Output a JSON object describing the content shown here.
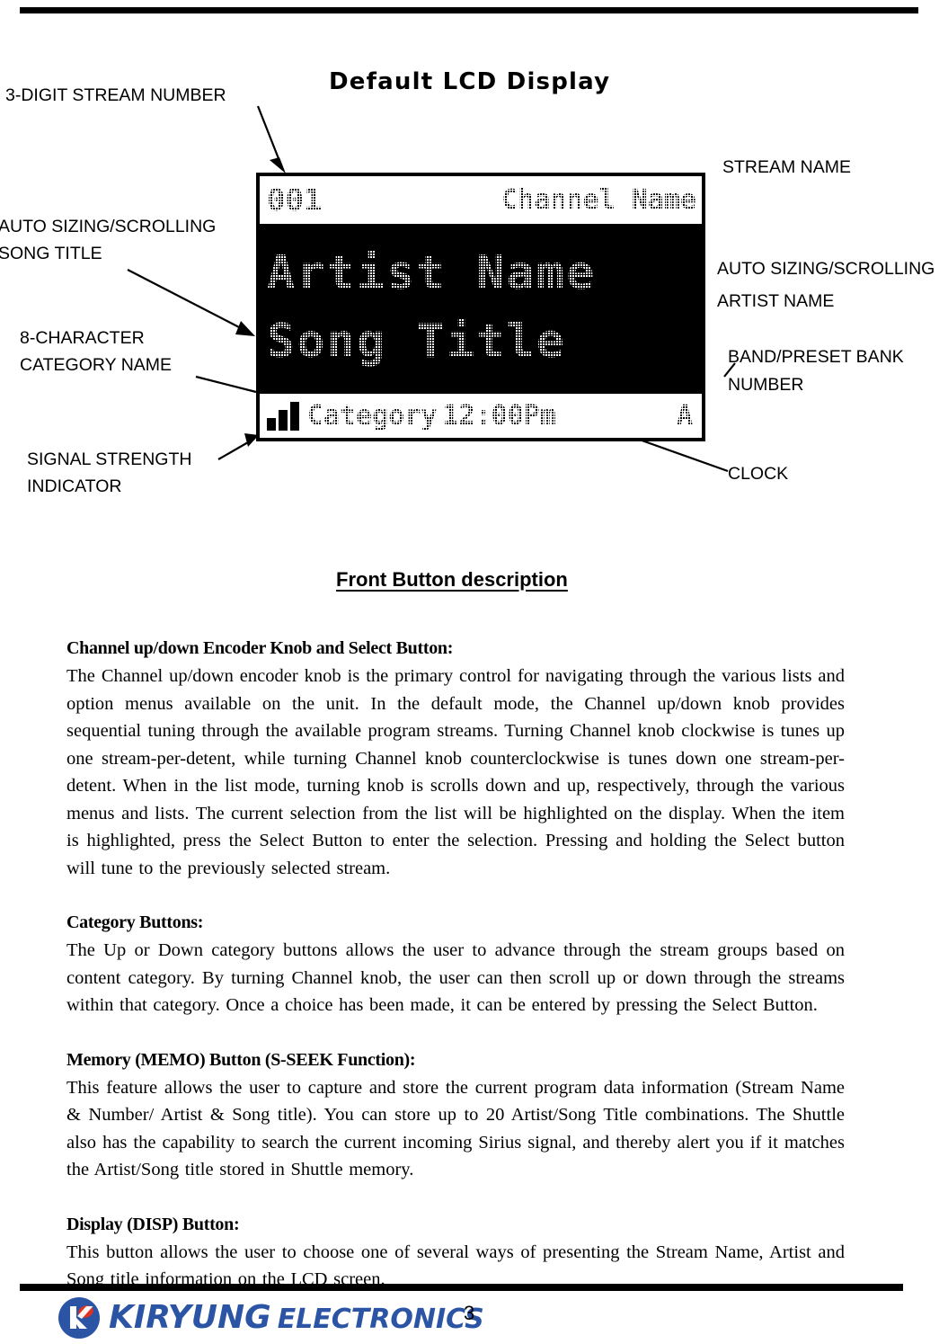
{
  "page": {
    "number": "3"
  },
  "headings": {
    "lcd_title": "Default LCD Display",
    "front_buttons_title": "Front Button description"
  },
  "callouts": {
    "stream_number": "3-DIGIT STREAM NUMBER",
    "song_title_line1": "AUTO SIZING/SCROLLING",
    "song_title_line2": "SONG TITLE",
    "category_line1": "8-CHARACTER",
    "category_line2": "CATEGORY NAME",
    "signal_line1": "SIGNAL STRENGTH",
    "signal_line2": "INDICATOR",
    "stream_name": "STREAM NAME",
    "artist_line1": "AUTO SIZING/SCROLLING",
    "artist_line2": "ARTIST NAME",
    "band_line1": "BAND/PRESET BANK",
    "band_line2": "NUMBER",
    "clock": "CLOCK"
  },
  "lcd": {
    "stream_number": "001",
    "channel_name": "Channel Name",
    "artist_name": "Artist Name",
    "song_title": "Song Title",
    "category": "Category",
    "clock": "12:00Pm",
    "band": "A",
    "signal_bars": 3
  },
  "sections": [
    {
      "heading": "Channel up/down Encoder Knob and Select Button:",
      "body": "The Channel up/down encoder knob is the primary control for navigating through the various lists and option menus available on the unit. In the default mode, the Channel up/down knob provides sequential tuning through the available program streams. Turning Channel knob clockwise is tunes up one stream-per-detent, while turning Channel knob counterclockwise is tunes down one stream-per-detent. When in the list mode, turning knob is scrolls down and up, respectively, through the various menus and lists. The current selection from the list will be highlighted on the display. When the item is highlighted, press the Select Button to enter the selection. Pressing and holding the Select button will tune to the previously selected stream."
    },
    {
      "heading": "Category Buttons:",
      "body": "The Up or Down category buttons allows the user to advance through the stream groups based on content category. By turning Channel knob, the user can then scroll up or down through the streams within that category. Once a choice has been made, it can be entered by pressing the Select Button."
    },
    {
      "heading": "Memory (MEMO) Button (S-SEEK Function):",
      "body": "This feature allows the user to capture and store the current program data information (Stream Name & Number/ Artist & Song title). You can store up to 20 Artist/Song Title combinations. The Shuttle also has the capability to search the current incoming Sirius signal, and thereby alert you if it matches the Artist/Song title stored in Shuttle memory."
    },
    {
      "heading": "Display (DISP) Button:",
      "body": "This button allows the user to choose one of several ways of presenting the Stream Name, Artist and Song title information on the LCD screen."
    }
  ],
  "footer": {
    "brand_word1": "KIRYUNG",
    "brand_word2": "ELECTRONICS",
    "brand_color": "#2b55a4",
    "accent_color": "#e03020"
  }
}
